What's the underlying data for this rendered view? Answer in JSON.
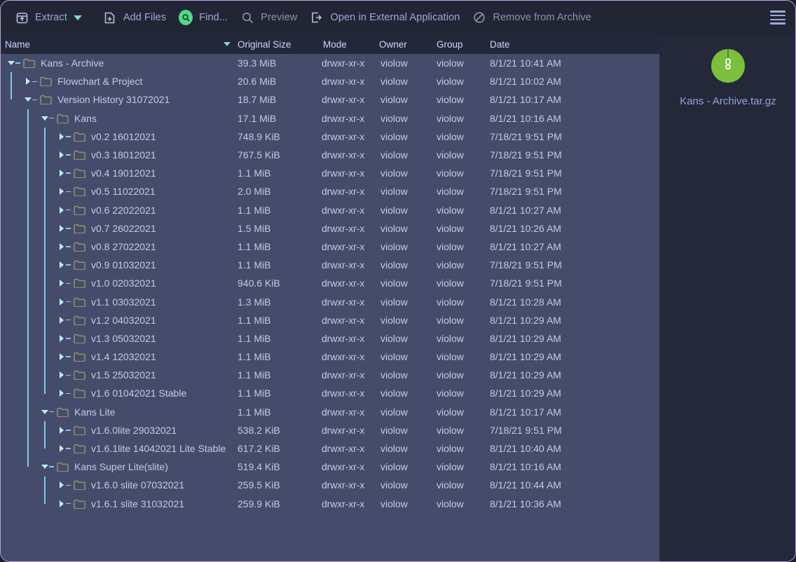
{
  "window": {
    "border_color": "#b9a3e3",
    "toolbar_bg": "#222634",
    "list_bg": "#454c6b",
    "sidebar_bg": "#242839",
    "accent_green": "#4fd98a",
    "accent_teal": "#7fd8d0",
    "link_color": "#9fa8da"
  },
  "toolbar": {
    "items": [
      {
        "label": "Extract",
        "icon": "extract-box-up-arrow-icon",
        "has_caret": true,
        "enabled": true
      },
      {
        "label": "Add Files",
        "icon": "file-plus-icon",
        "has_caret": false,
        "enabled": true
      },
      {
        "label": "Find...",
        "icon": "search-circle-icon",
        "has_caret": false,
        "enabled": true
      },
      {
        "label": "Preview",
        "icon": "magnifier-icon",
        "has_caret": false,
        "enabled": false
      },
      {
        "label": "Open in External Application",
        "icon": "external-open-icon",
        "has_caret": false,
        "enabled": true
      },
      {
        "label": "Remove from Archive",
        "icon": "prohibition-icon",
        "has_caret": false,
        "enabled": false
      }
    ],
    "menu_icon": "hamburger-menu-icon"
  },
  "columns": [
    {
      "key": "name",
      "label": "Name",
      "sorted": true,
      "sort_direction": "descending"
    },
    {
      "key": "size",
      "label": "Original Size"
    },
    {
      "key": "mode",
      "label": "Mode"
    },
    {
      "key": "owner",
      "label": "Owner"
    },
    {
      "key": "group",
      "label": "Group"
    },
    {
      "key": "date",
      "label": "Date"
    }
  ],
  "rows": [
    {
      "depth": 0,
      "state": "expanded",
      "name": "Kans - Archive",
      "size": "39.3 MiB",
      "mode": "drwxr-xr-x",
      "owner": "violow",
      "group": "violow",
      "date": "8/1/21 10:41 AM"
    },
    {
      "depth": 1,
      "state": "collapsed",
      "name": "Flowchart & Project",
      "size": "20.6 MiB",
      "mode": "drwxr-xr-x",
      "owner": "violow",
      "group": "violow",
      "date": "8/1/21 10:02 AM"
    },
    {
      "depth": 1,
      "state": "expanded",
      "name": "Version History 31072021",
      "size": "18.7 MiB",
      "mode": "drwxr-xr-x",
      "owner": "violow",
      "group": "violow",
      "date": "8/1/21 10:17 AM"
    },
    {
      "depth": 2,
      "state": "expanded",
      "name": "Kans",
      "size": "17.1 MiB",
      "mode": "drwxr-xr-x",
      "owner": "violow",
      "group": "violow",
      "date": "8/1/21 10:16 AM"
    },
    {
      "depth": 3,
      "state": "collapsed",
      "name": "v0.2 16012021",
      "size": "748.9 KiB",
      "mode": "drwxr-xr-x",
      "owner": "violow",
      "group": "violow",
      "date": "7/18/21 9:51 PM"
    },
    {
      "depth": 3,
      "state": "collapsed",
      "name": "v0.3 18012021",
      "size": "767.5 KiB",
      "mode": "drwxr-xr-x",
      "owner": "violow",
      "group": "violow",
      "date": "7/18/21 9:51 PM"
    },
    {
      "depth": 3,
      "state": "collapsed",
      "name": "v0.4 19012021",
      "size": "1.1 MiB",
      "mode": "drwxr-xr-x",
      "owner": "violow",
      "group": "violow",
      "date": "7/18/21 9:51 PM"
    },
    {
      "depth": 3,
      "state": "collapsed",
      "name": "v0.5 11022021",
      "size": "2.0 MiB",
      "mode": "drwxr-xr-x",
      "owner": "violow",
      "group": "violow",
      "date": "7/18/21 9:51 PM"
    },
    {
      "depth": 3,
      "state": "collapsed",
      "name": "v0.6 22022021",
      "size": "1.1 MiB",
      "mode": "drwxr-xr-x",
      "owner": "violow",
      "group": "violow",
      "date": "8/1/21 10:27 AM"
    },
    {
      "depth": 3,
      "state": "collapsed",
      "name": "v0.7 26022021",
      "size": "1.5 MiB",
      "mode": "drwxr-xr-x",
      "owner": "violow",
      "group": "violow",
      "date": "8/1/21 10:26 AM"
    },
    {
      "depth": 3,
      "state": "collapsed",
      "name": "v0.8 27022021",
      "size": "1.1 MiB",
      "mode": "drwxr-xr-x",
      "owner": "violow",
      "group": "violow",
      "date": "8/1/21 10:27 AM"
    },
    {
      "depth": 3,
      "state": "collapsed",
      "name": "v0.9 01032021",
      "size": "1.1 MiB",
      "mode": "drwxr-xr-x",
      "owner": "violow",
      "group": "violow",
      "date": "7/18/21 9:51 PM"
    },
    {
      "depth": 3,
      "state": "collapsed",
      "name": "v1.0 02032021",
      "size": "940.6 KiB",
      "mode": "drwxr-xr-x",
      "owner": "violow",
      "group": "violow",
      "date": "7/18/21 9:51 PM"
    },
    {
      "depth": 3,
      "state": "collapsed",
      "name": "v1.1 03032021",
      "size": "1.3 MiB",
      "mode": "drwxr-xr-x",
      "owner": "violow",
      "group": "violow",
      "date": "8/1/21 10:28 AM"
    },
    {
      "depth": 3,
      "state": "collapsed",
      "name": "v1.2 04032021",
      "size": "1.1 MiB",
      "mode": "drwxr-xr-x",
      "owner": "violow",
      "group": "violow",
      "date": "8/1/21 10:29 AM"
    },
    {
      "depth": 3,
      "state": "collapsed",
      "name": "v1.3 05032021",
      "size": "1.1 MiB",
      "mode": "drwxr-xr-x",
      "owner": "violow",
      "group": "violow",
      "date": "8/1/21 10:29 AM"
    },
    {
      "depth": 3,
      "state": "collapsed",
      "name": "v1.4 12032021",
      "size": "1.1 MiB",
      "mode": "drwxr-xr-x",
      "owner": "violow",
      "group": "violow",
      "date": "8/1/21 10:29 AM"
    },
    {
      "depth": 3,
      "state": "collapsed",
      "name": "v1.5 25032021",
      "size": "1.1 MiB",
      "mode": "drwxr-xr-x",
      "owner": "violow",
      "group": "violow",
      "date": "8/1/21 10:29 AM"
    },
    {
      "depth": 3,
      "state": "collapsed",
      "name": "v1.6 01042021 Stable",
      "size": "1.1 MiB",
      "mode": "drwxr-xr-x",
      "owner": "violow",
      "group": "violow",
      "date": "8/1/21 10:29 AM"
    },
    {
      "depth": 2,
      "state": "expanded",
      "name": "Kans Lite",
      "size": "1.1 MiB",
      "mode": "drwxr-xr-x",
      "owner": "violow",
      "group": "violow",
      "date": "8/1/21 10:17 AM"
    },
    {
      "depth": 3,
      "state": "collapsed",
      "name": "v1.6.0lite 29032021",
      "size": "538.2 KiB",
      "mode": "drwxr-xr-x",
      "owner": "violow",
      "group": "violow",
      "date": "7/18/21 9:51 PM"
    },
    {
      "depth": 3,
      "state": "collapsed",
      "name": "v1.6.1lite 14042021 Lite Stable",
      "size": "617.2 KiB",
      "mode": "drwxr-xr-x",
      "owner": "violow",
      "group": "violow",
      "date": "8/1/21 10:40 AM"
    },
    {
      "depth": 2,
      "state": "expanded",
      "name": "Kans Super Lite(slite)",
      "size": "519.4 KiB",
      "mode": "drwxr-xr-x",
      "owner": "violow",
      "group": "violow",
      "date": "8/1/21 10:16 AM"
    },
    {
      "depth": 3,
      "state": "collapsed",
      "name": "v1.6.0 slite 07032021",
      "size": "259.5 KiB",
      "mode": "drwxr-xr-x",
      "owner": "violow",
      "group": "violow",
      "date": "8/1/21 10:44 AM"
    },
    {
      "depth": 3,
      "state": "collapsed",
      "name": "v1.6.1 slite 31032021",
      "size": "259.9 KiB",
      "mode": "drwxr-xr-x",
      "owner": "violow",
      "group": "violow",
      "date": "8/1/21 10:36 AM"
    }
  ],
  "sidebar": {
    "archive_icon": "archive-gzip-icon",
    "archive_name": "Kans - Archive.tar.gz"
  }
}
